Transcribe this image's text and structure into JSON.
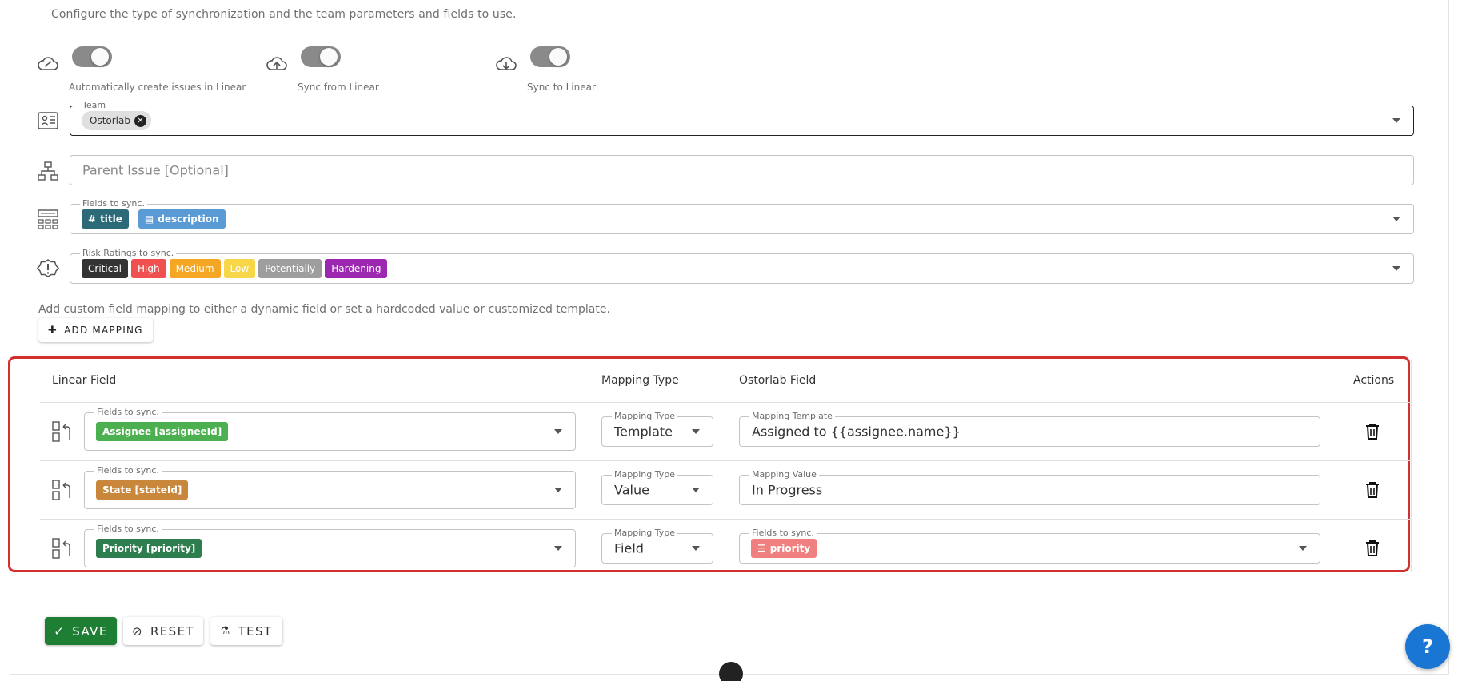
{
  "description": "Configure the type of synchronization and the team parameters and fields to use.",
  "toggles": [
    {
      "label": "Automatically create issues in Linear",
      "icon": "cloud-sync-icon",
      "on": true
    },
    {
      "label": "Sync from Linear",
      "icon": "cloud-upload-icon",
      "on": true
    },
    {
      "label": "Sync to Linear",
      "icon": "cloud-download-icon",
      "on": true
    }
  ],
  "team": {
    "legend": "Team",
    "chip": "Ostorlab"
  },
  "parent_issue": {
    "placeholder": "Parent Issue [Optional]"
  },
  "fields_to_sync": {
    "legend": "Fields to sync.",
    "chips": [
      {
        "label": "title",
        "icon": "hash-icon",
        "color": "#2d6a78"
      },
      {
        "label": "description",
        "icon": "text-icon",
        "color": "#5b9bd5"
      }
    ]
  },
  "risk_ratings": {
    "legend": "Risk Ratings to sync.",
    "chips": [
      {
        "label": "Critical",
        "color": "#333333"
      },
      {
        "label": "High",
        "color": "#f05050"
      },
      {
        "label": "Medium",
        "color": "#f5a623"
      },
      {
        "label": "Low",
        "color": "#f7d64a"
      },
      {
        "label": "Potentially",
        "color": "#9e9e9e"
      },
      {
        "label": "Hardening",
        "color": "#9c27b0"
      }
    ]
  },
  "custom_mapping_note": "Add custom field mapping to either a dynamic field or set a hardcoded value or customized template.",
  "add_mapping_label": "ADD MAPPING",
  "table": {
    "headers": {
      "linear_field": "Linear Field",
      "mapping_type": "Mapping Type",
      "ostorlab_field": "Ostorlab Field",
      "actions": "Actions"
    },
    "rows": [
      {
        "field_legend": "Fields to sync.",
        "field_chip": "Assignee [assigneeId]",
        "chip_color": "#4caf50",
        "type_legend": "Mapping Type",
        "type_value": "Template",
        "target_legend": "Mapping Template",
        "target_value": "Assigned to {{assignee.name}}"
      },
      {
        "field_legend": "Fields to sync.",
        "field_chip": "State [stateId]",
        "chip_color": "#c8873a",
        "type_legend": "Mapping Type",
        "type_value": "Value",
        "target_legend": "Mapping Value",
        "target_value": "In Progress"
      },
      {
        "field_legend": "Fields to sync.",
        "field_chip": "Priority [priority]",
        "chip_color": "#2e7d4f",
        "type_legend": "Mapping Type",
        "type_value": "Field",
        "target_legend": "Fields to sync.",
        "target_chip": "priority",
        "target_chip_color": "#f08080"
      }
    ]
  },
  "footer": {
    "save": "SAVE",
    "reset": "RESET",
    "test": "TEST"
  },
  "help_label": "?",
  "accent_color": "#1976d2",
  "highlight_color": "#d32f2f"
}
